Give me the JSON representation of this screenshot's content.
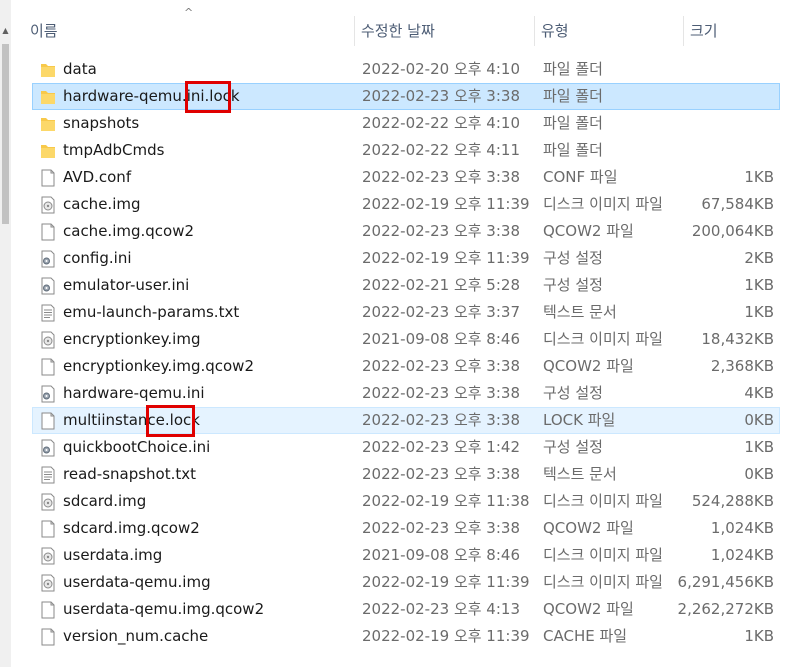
{
  "header": {
    "name_label": "이름",
    "date_label": "수정한 날짜",
    "type_label": "유형",
    "size_label": "크기",
    "sort_indicator": "^"
  },
  "files": [
    {
      "name": "data",
      "date": "2022-02-20 오후 4:10",
      "type": "파일 폴더",
      "size": "",
      "icon": "folder-icon"
    },
    {
      "name": "hardware-qemu.ini.lock",
      "date": "2022-02-23 오후 3:38",
      "type": "파일 폴더",
      "size": "",
      "icon": "folder-icon"
    },
    {
      "name": "snapshots",
      "date": "2022-02-22 오후 4:10",
      "type": "파일 폴더",
      "size": "",
      "icon": "folder-icon"
    },
    {
      "name": "tmpAdbCmds",
      "date": "2022-02-22 오후 4:11",
      "type": "파일 폴더",
      "size": "",
      "icon": "folder-icon"
    },
    {
      "name": "AVD.conf",
      "date": "2022-02-23 오후 3:38",
      "type": "CONF 파일",
      "size": "1KB",
      "icon": "file-icon"
    },
    {
      "name": "cache.img",
      "date": "2022-02-19 오후 11:39",
      "type": "디스크 이미지 파일",
      "size": "67,584KB",
      "icon": "disc-image-icon"
    },
    {
      "name": "cache.img.qcow2",
      "date": "2022-02-23 오후 3:38",
      "type": "QCOW2 파일",
      "size": "200,064KB",
      "icon": "file-icon"
    },
    {
      "name": "config.ini",
      "date": "2022-02-19 오후 11:39",
      "type": "구성 설정",
      "size": "2KB",
      "icon": "settings-file-icon"
    },
    {
      "name": "emulator-user.ini",
      "date": "2022-02-21 오후 5:28",
      "type": "구성 설정",
      "size": "1KB",
      "icon": "settings-file-icon"
    },
    {
      "name": "emu-launch-params.txt",
      "date": "2022-02-23 오후 3:37",
      "type": "텍스트 문서",
      "size": "1KB",
      "icon": "text-file-icon"
    },
    {
      "name": "encryptionkey.img",
      "date": "2021-09-08 오후 8:46",
      "type": "디스크 이미지 파일",
      "size": "18,432KB",
      "icon": "disc-image-icon"
    },
    {
      "name": "encryptionkey.img.qcow2",
      "date": "2022-02-23 오후 3:38",
      "type": "QCOW2 파일",
      "size": "2,368KB",
      "icon": "file-icon"
    },
    {
      "name": "hardware-qemu.ini",
      "date": "2022-02-23 오후 3:38",
      "type": "구성 설정",
      "size": "4KB",
      "icon": "settings-file-icon"
    },
    {
      "name": "multiinstance.lock",
      "date": "2022-02-23 오후 3:38",
      "type": "LOCK 파일",
      "size": "0KB",
      "icon": "file-icon"
    },
    {
      "name": "quickbootChoice.ini",
      "date": "2022-02-23 오후 1:42",
      "type": "구성 설정",
      "size": "1KB",
      "icon": "settings-file-icon"
    },
    {
      "name": "read-snapshot.txt",
      "date": "2022-02-23 오후 3:38",
      "type": "텍스트 문서",
      "size": "0KB",
      "icon": "text-file-icon"
    },
    {
      "name": "sdcard.img",
      "date": "2022-02-19 오후 11:38",
      "type": "디스크 이미지 파일",
      "size": "524,288KB",
      "icon": "disc-image-icon"
    },
    {
      "name": "sdcard.img.qcow2",
      "date": "2022-02-23 오후 3:38",
      "type": "QCOW2 파일",
      "size": "1,024KB",
      "icon": "file-icon"
    },
    {
      "name": "userdata.img",
      "date": "2021-09-08 오후 8:46",
      "type": "디스크 이미지 파일",
      "size": "1,024KB",
      "icon": "disc-image-icon"
    },
    {
      "name": "userdata-qemu.img",
      "date": "2022-02-19 오후 11:39",
      "type": "디스크 이미지 파일",
      "size": "6,291,456KB",
      "icon": "disc-image-icon"
    },
    {
      "name": "userdata-qemu.img.qcow2",
      "date": "2022-02-23 오후 4:13",
      "type": "QCOW2 파일",
      "size": "2,262,272KB",
      "icon": "file-icon"
    },
    {
      "name": "version_num.cache",
      "date": "2022-02-19 오후 11:39",
      "type": "CACHE 파일",
      "size": "1KB",
      "icon": "file-icon"
    }
  ],
  "selected_row_index": 1,
  "hover_row_index": 13,
  "colors": {
    "folder": "#f8c94a",
    "selection": "#cce8ff",
    "annotation": "#e00000"
  }
}
